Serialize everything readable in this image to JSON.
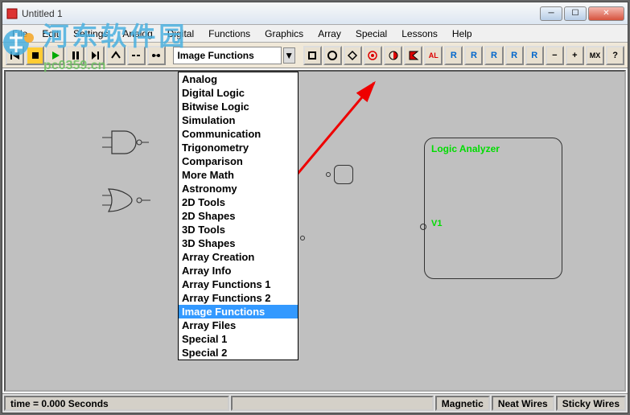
{
  "window": {
    "title": "Untitled 1"
  },
  "menus": [
    "File",
    "Edit",
    "Settings",
    "Analog",
    "Digital",
    "Functions",
    "Graphics",
    "Array",
    "Special",
    "Lessons",
    "Help"
  ],
  "dropdown": {
    "selected": "Image Functions",
    "items": [
      "Analog",
      "Digital Logic",
      "Bitwise Logic",
      "Simulation",
      "Communication",
      "Trigonometry",
      "Comparison",
      "More Math",
      "Astronomy",
      "2D Tools",
      "2D Shapes",
      "3D Tools",
      "3D Shapes",
      "Array Creation",
      "Array Info",
      "Array Functions 1",
      "Array Functions 2",
      "Image Functions",
      "Array Files",
      "Special 1",
      "Special 2"
    ]
  },
  "toolbar_right_labels": [
    "AL",
    "R",
    "R",
    "R",
    "R",
    "R",
    "−",
    "+",
    "MX",
    "?"
  ],
  "logic_analyzer": {
    "title": "Logic Analyzer",
    "port": "V1"
  },
  "status": {
    "time": "time = 0.000 Seconds",
    "magnetic": "Magnetic",
    "neat_wires": "Neat Wires",
    "sticky_wires": "Sticky Wires"
  },
  "watermark": {
    "text": "河东软件园",
    "url": "pc0359.cn"
  }
}
